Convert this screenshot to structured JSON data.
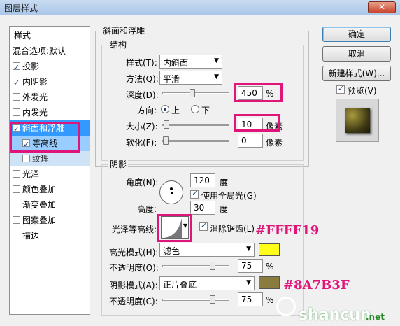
{
  "window": {
    "title": "图层样式",
    "close_glyph": "✕"
  },
  "stylelist": {
    "header": "样式",
    "items": [
      {
        "label": "混合选项:默认",
        "checkbox": false,
        "checked": false
      },
      {
        "label": "投影",
        "checkbox": true,
        "checked": true
      },
      {
        "label": "内阴影",
        "checkbox": true,
        "checked": true
      },
      {
        "label": "外发光",
        "checkbox": true,
        "checked": false
      },
      {
        "label": "内发光",
        "checkbox": true,
        "checked": false
      },
      {
        "label": "斜面和浮雕",
        "checkbox": true,
        "checked": true
      },
      {
        "label": "等高线",
        "checkbox": true,
        "checked": true
      },
      {
        "label": "纹理",
        "checkbox": true,
        "checked": false
      },
      {
        "label": "光泽",
        "checkbox": true,
        "checked": false
      },
      {
        "label": "颜色叠加",
        "checkbox": true,
        "checked": false
      },
      {
        "label": "渐变叠加",
        "checkbox": true,
        "checked": false
      },
      {
        "label": "图案叠加",
        "checkbox": true,
        "checked": false
      },
      {
        "label": "描边",
        "checkbox": true,
        "checked": false
      }
    ]
  },
  "bevel": {
    "group_title": "斜面和浮雕",
    "structure_title": "结构",
    "style_label": "样式(T):",
    "style_value": "内斜面",
    "method_label": "方法(Q):",
    "method_value": "平滑",
    "depth_label": "深度(D):",
    "depth_value": "450",
    "depth_unit": "%",
    "depth_level": 0.45,
    "direction_label": "方向:",
    "dir_up": "上",
    "dir_down": "下",
    "direction_selected": "上",
    "size_label": "大小(Z):",
    "size_value": "10",
    "size_unit": "像素",
    "size_level": 0.05,
    "soften_label": "软化(F):",
    "soften_value": "0",
    "soften_unit": "像素",
    "soften_level": 0
  },
  "shading": {
    "group_title": "阴影",
    "angle_label": "角度(N):",
    "angle_value": "120",
    "angle_unit": "度",
    "global_light_label": "使用全局光(G)",
    "global_light_checked": true,
    "altitude_label": "高度:",
    "altitude_value": "30",
    "altitude_unit": "度",
    "gloss_contour_label": "光泽等高线:",
    "anti_alias_label": "消除锯齿(L)",
    "anti_alias_checked": true,
    "highlight_mode_label": "高光模式(H):",
    "highlight_mode_value": "滤色",
    "highlight_color": "#FFFF19",
    "highlight_opacity_label": "不透明度(O):",
    "highlight_opacity_value": "75",
    "highlight_opacity_unit": "%",
    "highlight_opacity_level": 0.75,
    "shadow_mode_label": "阴影模式(A):",
    "shadow_mode_value": "正片叠底",
    "shadow_color": "#8A7B3F",
    "shadow_opacity_label": "不透明度(C):",
    "shadow_opacity_value": "75",
    "shadow_opacity_unit": "%",
    "shadow_opacity_level": 0.75
  },
  "buttons": {
    "ok": "确定",
    "cancel": "取消",
    "new_style": "新建样式(W)...",
    "preview": "预览(V)",
    "preview_checked": true
  },
  "annotations": {
    "highlight_hex": "#FFFF19",
    "shadow_hex": "#8A7B3F"
  },
  "watermark": {
    "text": "shancun",
    "domain": ".net"
  }
}
